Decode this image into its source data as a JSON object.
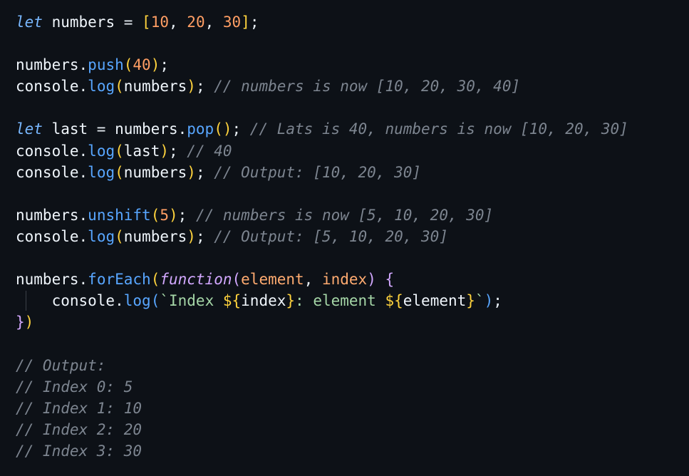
{
  "code": {
    "l1": {
      "kw": "let",
      "var": "numbers",
      "eq": " = ",
      "ob": "[",
      "n1": "10",
      "c1": ", ",
      "n2": "20",
      "c2": ", ",
      "n3": "30",
      "cb": "]",
      "semi": ";"
    },
    "l3": {
      "obj": "numbers",
      "dot": ".",
      "method": "push",
      "op": "(",
      "num": "40",
      "cp": ")",
      "semi": ";"
    },
    "l4": {
      "obj": "console",
      "dot": ".",
      "method": "log",
      "op": "(",
      "arg": "numbers",
      "cp": ")",
      "semi": ";",
      "comment": " // numbers is now [10, 20, 30, 40]"
    },
    "l6": {
      "kw": "let",
      "var": " last",
      "eq": " = ",
      "obj": "numbers",
      "dot": ".",
      "method": "pop",
      "parens": "()",
      "semi": ";",
      "comment": " // Lats is 40, numbers is now [10, 20, 30]"
    },
    "l7": {
      "obj": "console",
      "dot": ".",
      "method": "log",
      "op": "(",
      "arg": "last",
      "cp": ")",
      "semi": ";",
      "comment": " // 40"
    },
    "l8": {
      "obj": "console",
      "dot": ".",
      "method": "log",
      "op": "(",
      "arg": "numbers",
      "cp": ")",
      "semi": ";",
      "comment": " // Output: [10, 20, 30]"
    },
    "l10": {
      "obj": "numbers",
      "dot": ".",
      "method": "unshift",
      "op": "(",
      "num": "5",
      "cp": ")",
      "semi": ";",
      "comment": " // numbers is now [5, 10, 20, 30]"
    },
    "l11": {
      "obj": "console",
      "dot": ".",
      "method": "log",
      "op": "(",
      "arg": "numbers",
      "cp": ")",
      "semi": ";",
      "comment": " // Output: [5, 10, 20, 30]"
    },
    "l13": {
      "obj": "numbers",
      "dot": ".",
      "method": "forEach",
      "op": "(",
      "fnkw": "function",
      "pop": "(",
      "p1": "element",
      "comma": ", ",
      "p2": "index",
      "pcp": ")",
      "brace": " {"
    },
    "l14": {
      "indent": "    ",
      "obj": "console",
      "dot": ".",
      "method": "log",
      "op": "(",
      "tick": "`",
      "s1": "Index ",
      "i1o": "${",
      "i1": "index",
      "i1c": "}",
      "s2": ": element ",
      "i2o": "${",
      "i2": "element",
      "i2c": "}",
      "tick2": "`",
      "cp": ")",
      "semi": ";"
    },
    "l15": {
      "brace": "}",
      "cp": ")"
    },
    "l17": "// Output:",
    "l18": "// Index 0: 5",
    "l19": "// Index 1: 10",
    "l20": "// Index 2: 20",
    "l21": "// Index 3: 30"
  },
  "colors": {
    "background": "#0d1117",
    "keyword": "#79b8ff",
    "number": "#ff9e64",
    "method": "#58a6ff",
    "comment": "#7d8590",
    "string": "#a5d6a7"
  }
}
